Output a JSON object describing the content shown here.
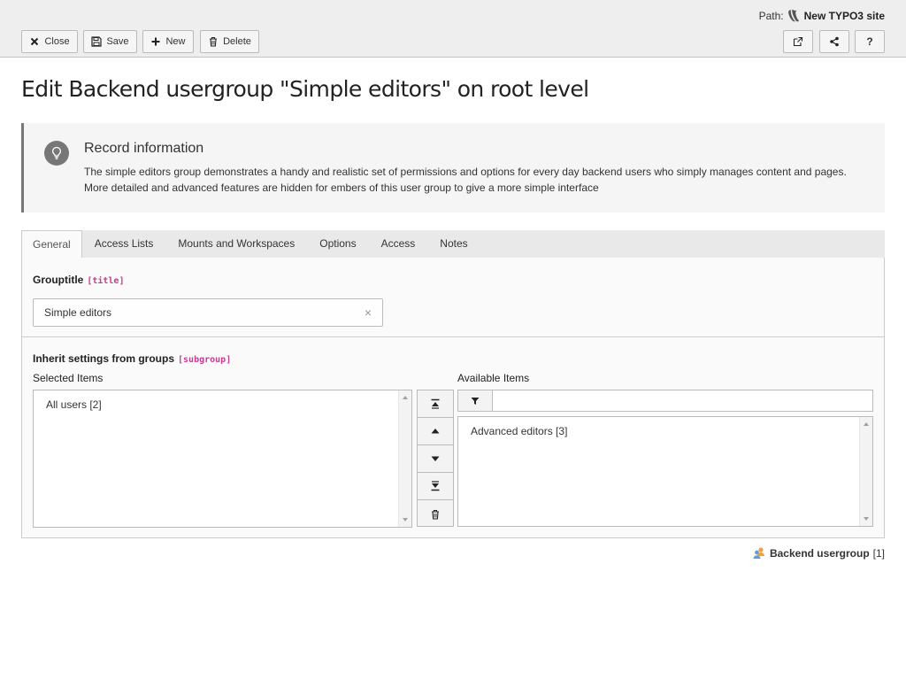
{
  "header": {
    "path_label": "Path:",
    "site_name": "New TYPO3 site",
    "buttons": {
      "close": "Close",
      "save": "Save",
      "new": "New",
      "delete": "Delete",
      "help": "?"
    }
  },
  "page": {
    "title": "Edit Backend usergroup \"Simple editors\" on root level"
  },
  "callout": {
    "title": "Record information",
    "text": "The simple editors group demonstrates a handy and realistic set of permissions and options for every day backend users who simply manages content and pages. More detailed and advanced features are hidden for embers of this user group to give a more simple interface"
  },
  "tabs": [
    {
      "label": "General",
      "active": true
    },
    {
      "label": "Access Lists",
      "active": false
    },
    {
      "label": "Mounts and Workspaces",
      "active": false
    },
    {
      "label": "Options",
      "active": false
    },
    {
      "label": "Access",
      "active": false
    },
    {
      "label": "Notes",
      "active": false
    }
  ],
  "form": {
    "grouptitle": {
      "label": "Grouptitle",
      "field": "[title]",
      "value": "Simple editors"
    },
    "subgroup": {
      "label": "Inherit settings from groups",
      "field": "[subgroup]",
      "selected_label": "Selected Items",
      "available_label": "Available Items",
      "selected_items": [
        "All users [2]"
      ],
      "available_items": [
        "Advanced editors [3]"
      ],
      "filter_value": ""
    }
  },
  "footer": {
    "record_type": "Backend usergroup",
    "record_uid": "[1]"
  },
  "colors": {
    "field_code": "#c83c91",
    "header_bg": "#eeeeee",
    "callout_border": "#777777"
  }
}
